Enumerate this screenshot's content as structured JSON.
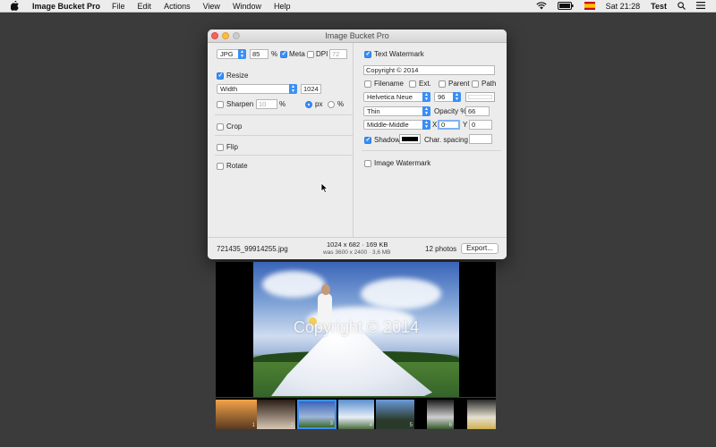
{
  "menubar": {
    "app_name": "Image Bucket Pro",
    "menus": [
      "File",
      "Edit",
      "Actions",
      "View",
      "Window",
      "Help"
    ],
    "clock": "Sat 21:28",
    "user": "Test"
  },
  "window": {
    "title": "Image Bucket Pro",
    "left": {
      "format": "JPG",
      "quality": "85",
      "quality_unit": "%",
      "meta_label": "Meta",
      "dpi_label": "DPI",
      "dpi_value": "72",
      "resize_label": "Resize",
      "resize_mode": "Width",
      "resize_value": "1024",
      "sharpen_label": "Sharpen",
      "sharpen_value": "10",
      "sharpen_unit": "%",
      "px_label": "px",
      "percent_label": "%",
      "crop_label": "Crop",
      "flip_label": "Flip",
      "rotate_label": "Rotate"
    },
    "right": {
      "text_watermark_label": "Text Watermark",
      "watermark_text": "Copyright © 2014",
      "filename_label": "Filename",
      "ext_label": "Ext.",
      "parent_label": "Parent",
      "path_label": "Path",
      "font": "Helvetica Neue",
      "font_size": "96",
      "weight": "Thin",
      "opacity_label": "Opacity %",
      "opacity_value": "66",
      "position": "Middle-Middle",
      "x_label": "X",
      "x_value": "0",
      "y_label": "Y",
      "y_value": "0",
      "shadow_label": "Shadow",
      "char_spacing_label": "Char. spacing",
      "char_spacing_value": "",
      "image_watermark_label": "Image Watermark"
    },
    "status": {
      "filename": "721435_99914255.jpg",
      "dimensions": "1024 x 682 · 169 KB",
      "original": "was 3600 x 2400 · 3,6 MB",
      "count": "12 photos",
      "export_label": "Export..."
    }
  },
  "preview": {
    "watermark": "Copyright © 2014"
  },
  "thumbnails": [
    "1",
    "2",
    "3",
    "4",
    "5",
    "6",
    "7"
  ],
  "colors": {
    "accent": "#3a8ff5",
    "text_color_swatch": "#ffffff",
    "shadow_color_swatch": "#000000"
  }
}
